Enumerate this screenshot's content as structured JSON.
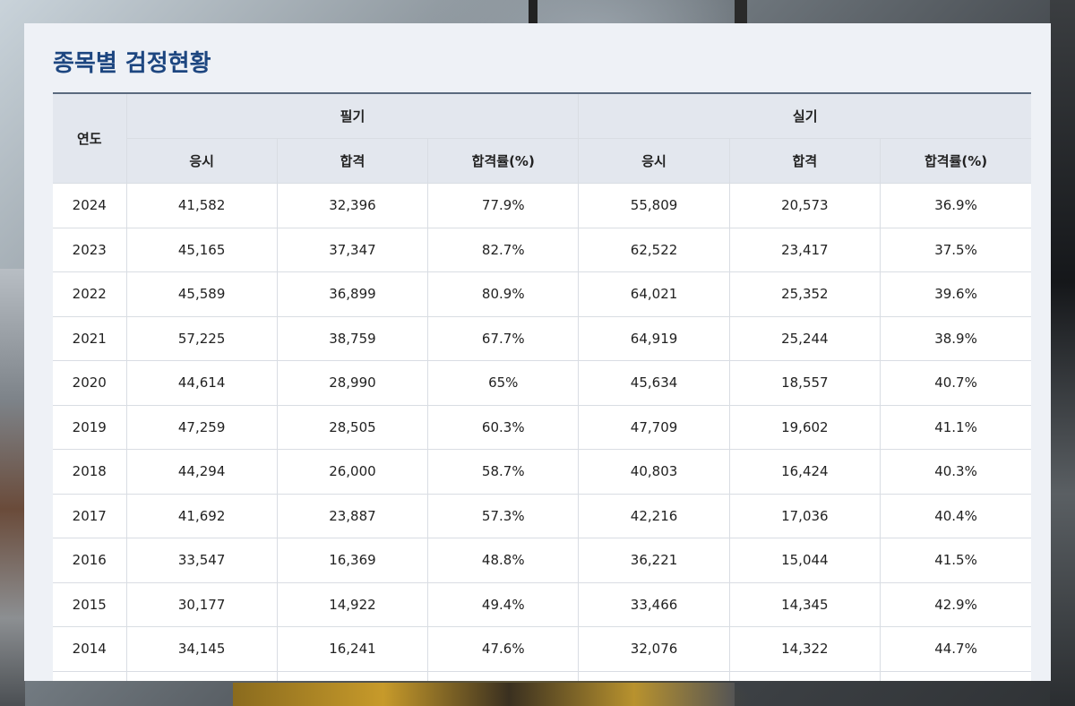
{
  "page": {
    "title": "종목별 검정현황"
  },
  "table": {
    "year_header": "연도",
    "group_headers": [
      "필기",
      "실기"
    ],
    "sub_headers": [
      "응시",
      "합격",
      "합격률(%)",
      "응시",
      "합격",
      "합격률(%)"
    ],
    "rows": [
      [
        "2024",
        "41,582",
        "32,396",
        "77.9%",
        "55,809",
        "20,573",
        "36.9%"
      ],
      [
        "2023",
        "45,165",
        "37,347",
        "82.7%",
        "62,522",
        "23,417",
        "37.5%"
      ],
      [
        "2022",
        "45,589",
        "36,899",
        "80.9%",
        "64,021",
        "25,352",
        "39.6%"
      ],
      [
        "2021",
        "57,225",
        "38,759",
        "67.7%",
        "64,919",
        "25,244",
        "38.9%"
      ],
      [
        "2020",
        "44,614",
        "28,990",
        "65%",
        "45,634",
        "18,557",
        "40.7%"
      ],
      [
        "2019",
        "47,259",
        "28,505",
        "60.3%",
        "47,709",
        "19,602",
        "41.1%"
      ],
      [
        "2018",
        "44,294",
        "26,000",
        "58.7%",
        "40,803",
        "16,424",
        "40.3%"
      ],
      [
        "2017",
        "41,692",
        "23,887",
        "57.3%",
        "42,216",
        "17,036",
        "40.4%"
      ],
      [
        "2016",
        "33,547",
        "16,369",
        "48.8%",
        "36,221",
        "15,044",
        "41.5%"
      ],
      [
        "2015",
        "30,177",
        "14,922",
        "49.4%",
        "33,466",
        "14,345",
        "42.9%"
      ],
      [
        "2014",
        "34,145",
        "16,241",
        "47.6%",
        "32,076",
        "14,322",
        "44.7%"
      ],
      [
        "",
        "",
        "",
        "",
        "",
        "",
        ""
      ]
    ]
  }
}
